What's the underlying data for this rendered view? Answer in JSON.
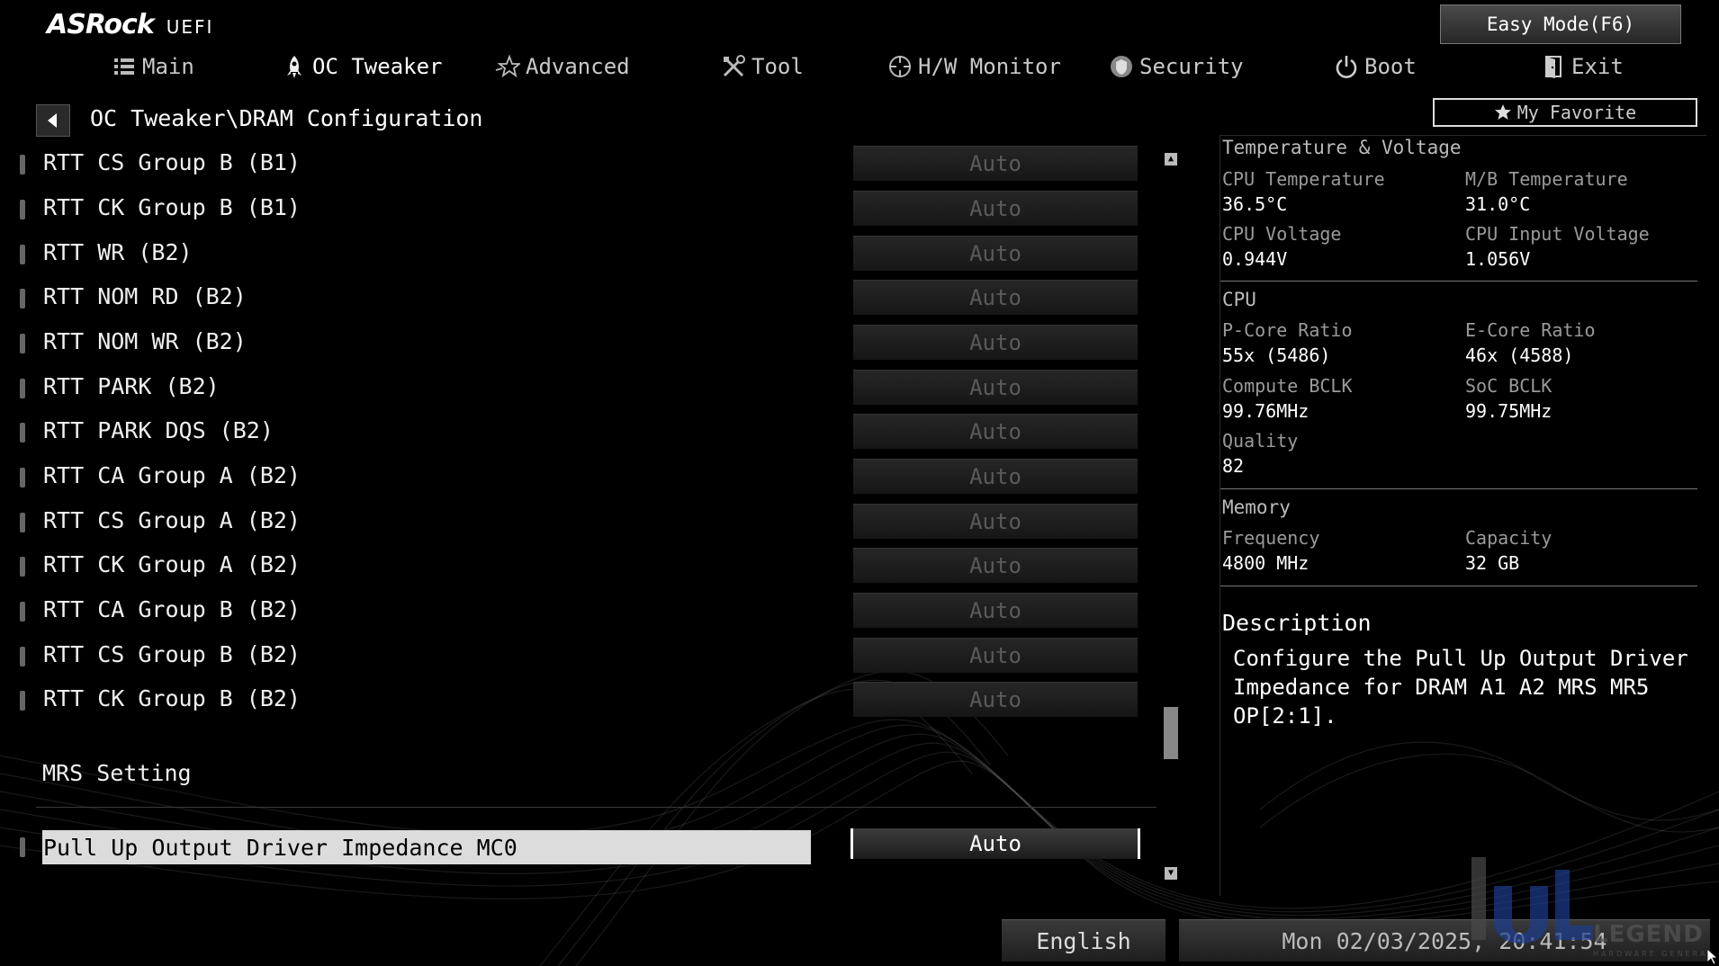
{
  "header": {
    "brand": "ASRock",
    "brand_sub": "UEFI",
    "easy_mode_label": "Easy Mode(F6)"
  },
  "nav": {
    "items": [
      {
        "label": "Main",
        "icon": "list-icon"
      },
      {
        "label": "OC Tweaker",
        "icon": "rocket-icon",
        "active": true
      },
      {
        "label": "Advanced",
        "icon": "star-icon"
      },
      {
        "label": "Tool",
        "icon": "tools-icon"
      },
      {
        "label": "H/W Monitor",
        "icon": "crosshair-icon"
      },
      {
        "label": "Security",
        "icon": "shield-icon"
      },
      {
        "label": "Boot",
        "icon": "power-icon"
      },
      {
        "label": "Exit",
        "icon": "door-icon"
      }
    ]
  },
  "breadcrumb": "OC Tweaker\\DRAM Configuration",
  "favorite_label": "My Favorite",
  "settings": [
    {
      "label": "RTT CS Group B (B1)",
      "value": "Auto"
    },
    {
      "label": "RTT CK Group B (B1)",
      "value": "Auto"
    },
    {
      "label": "RTT WR (B2)",
      "value": "Auto"
    },
    {
      "label": "RTT NOM RD (B2)",
      "value": "Auto"
    },
    {
      "label": "RTT NOM WR (B2)",
      "value": "Auto"
    },
    {
      "label": "RTT PARK (B2)",
      "value": "Auto"
    },
    {
      "label": "RTT PARK DQS (B2)",
      "value": "Auto"
    },
    {
      "label": "RTT CA Group A (B2)",
      "value": "Auto"
    },
    {
      "label": "RTT CS Group A (B2)",
      "value": "Auto"
    },
    {
      "label": "RTT CK Group A (B2)",
      "value": "Auto"
    },
    {
      "label": "RTT CA Group B (B2)",
      "value": "Auto"
    },
    {
      "label": "RTT CS Group B (B2)",
      "value": "Auto"
    },
    {
      "label": "RTT CK Group B (B2)",
      "value": "Auto"
    }
  ],
  "section_title": "MRS Setting",
  "selected_setting": {
    "label": "Pull Up Output Driver Impedance MC0",
    "value": "Auto"
  },
  "panel": {
    "temp_voltage": {
      "title": "Temperature & Voltage",
      "cpu_temp_label": "CPU Temperature",
      "cpu_temp": "36.5°C",
      "mb_temp_label": "M/B Temperature",
      "mb_temp": "31.0°C",
      "cpu_voltage_label": "CPU Voltage",
      "cpu_voltage": "0.944V",
      "cpu_input_voltage_label": "CPU Input Voltage",
      "cpu_input_voltage": "1.056V"
    },
    "cpu": {
      "title": "CPU",
      "pcore_label": "P-Core Ratio",
      "pcore": "55x (5486)",
      "ecore_label": "E-Core Ratio",
      "ecore": "46x (4588)",
      "compute_bclk_label": "Compute BCLK",
      "compute_bclk": "99.76MHz",
      "soc_bclk_label": "SoC BCLK",
      "soc_bclk": "99.75MHz",
      "quality_label": "Quality",
      "quality": "82"
    },
    "memory": {
      "title": "Memory",
      "frequency_label": "Frequency",
      "frequency": "4800 MHz",
      "capacity_label": "Capacity",
      "capacity": "32 GB"
    },
    "description": {
      "title": "Description",
      "text": "Configure the Pull Up Output Driver Impedance for DRAM A1 A2 MRS MR5 OP[2:1]."
    }
  },
  "footer": {
    "language": "English",
    "datetime": "Mon 02/03/2025, 20:41:54"
  },
  "watermark": {
    "text": "LEGEND",
    "sub": "HARDWARE GENERATION"
  },
  "colors": {
    "background": "#000000",
    "highlight": "#dcdcdc",
    "muted_value": "#5a5a5a"
  }
}
